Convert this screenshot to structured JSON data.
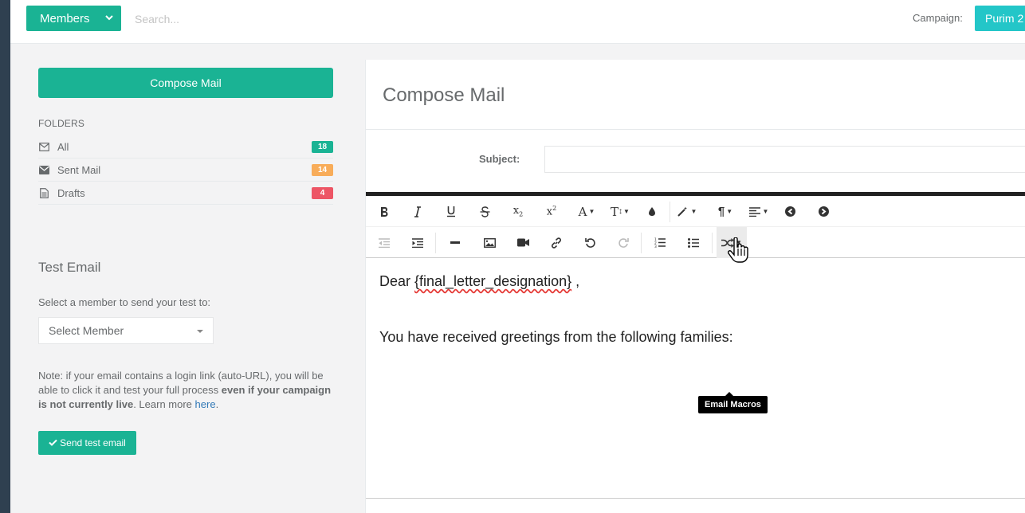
{
  "topbar": {
    "members_label": "Members",
    "search_placeholder": "Search...",
    "campaign_label": "Campaign:",
    "campaign_value": "Purim 2"
  },
  "sidebar": {
    "compose_label": "Compose Mail",
    "folders_title": "FOLDERS",
    "folders": [
      {
        "label": "All",
        "count": "18",
        "color": "#1ab394",
        "icon": "envelope-outline-icon"
      },
      {
        "label": "Sent Mail",
        "count": "14",
        "color": "#f8ac59",
        "icon": "envelope-filled-icon"
      },
      {
        "label": "Drafts",
        "count": "4",
        "color": "#ed5565",
        "icon": "file-text-icon"
      }
    ],
    "test_title": "Test Email",
    "test_label": "Select a member to send your test to:",
    "select_placeholder": "Select Member",
    "note_part1": "Note: if your email contains a login link (auto-URL), you will be able to click it and test your full process ",
    "note_bold": "even if your campaign is not currently live",
    "note_part2": ". Learn more ",
    "note_link": "here",
    "note_end": ".",
    "send_label": "Send test email"
  },
  "compose": {
    "title": "Compose Mail",
    "subject_label": "Subject:",
    "subject_value": "",
    "tooltip": "Email Macros",
    "body_prefix": "Dear ",
    "body_macro": "{final_letter_designation}",
    "body_suffix": " ,",
    "body_line2": "You have received greetings from the following families:"
  },
  "colors": {
    "primary": "#1ab394",
    "info": "#23c6c8",
    "warning": "#f8ac59",
    "danger": "#ed5565"
  }
}
